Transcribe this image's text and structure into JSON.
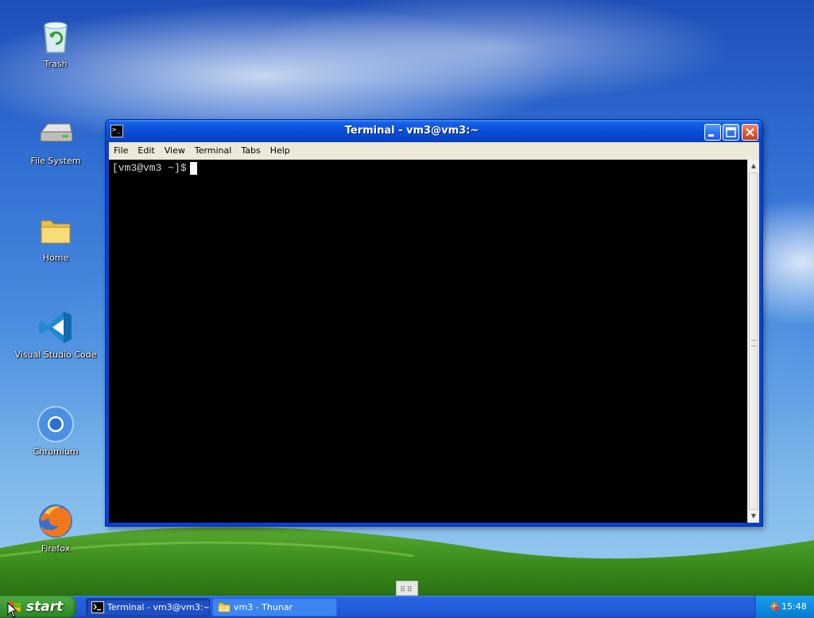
{
  "desktop": {
    "icons": [
      {
        "label": "Trash",
        "icon": "trash-icon"
      },
      {
        "label": "File System",
        "icon": "drive-icon"
      },
      {
        "label": "Home",
        "icon": "folder-icon"
      },
      {
        "label": "Visual Studio Code",
        "icon": "vscode-icon"
      },
      {
        "label": "Chromium",
        "icon": "chromium-icon"
      },
      {
        "label": "Firefox",
        "icon": "firefox-icon"
      }
    ]
  },
  "window": {
    "title": "Terminal - vm3@vm3:~",
    "menu": [
      "File",
      "Edit",
      "View",
      "Terminal",
      "Tabs",
      "Help"
    ],
    "prompt": "[vm3@vm3 ~]$"
  },
  "panel": {
    "handle_glyph": "⠿⠿"
  },
  "taskbar": {
    "start_label": "start",
    "tasks": [
      {
        "label": "Terminal - vm3@vm3:~",
        "icon": "terminal-icon",
        "active": true
      },
      {
        "label": "vm3 - Thunar",
        "icon": "folder-icon",
        "active": false
      }
    ],
    "clock": "15:48"
  },
  "colors": {
    "titlebar": "#0a4fd7",
    "taskbar": "#245edb",
    "start_button": "#3c9a35",
    "terminal_bg": "#000000"
  }
}
